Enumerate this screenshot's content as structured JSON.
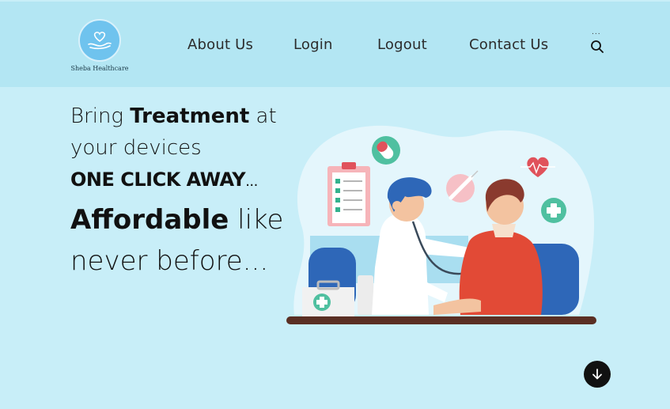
{
  "brand": {
    "name": "Sheba Healthcare",
    "logo_icon": "heart-hand-icon",
    "logo_color": "#6fc3ee"
  },
  "nav": {
    "items": [
      {
        "label": "About Us"
      },
      {
        "label": "Login"
      },
      {
        "label": "Logout"
      },
      {
        "label": "Contact Us"
      }
    ],
    "search_icon": "search-icon",
    "menu_dots": "..."
  },
  "hero": {
    "line1_pre": "Bring ",
    "line1_bold": "Treatment",
    "line1_post": " at",
    "line2": "your devices",
    "line3_bold": "ONE CLICK AWAY",
    "line3_tail": "...",
    "line4_bold": "Affordable",
    "line4_post": " like",
    "line5": "never before..."
  },
  "illustration": {
    "subject": "doctor-examining-patient-illustration"
  },
  "scroll_button": {
    "icon": "arrow-down-icon"
  },
  "colors": {
    "page_bg": "#c8eef8",
    "nav_bg": "#b3e6f3",
    "button_bg": "#111111"
  }
}
